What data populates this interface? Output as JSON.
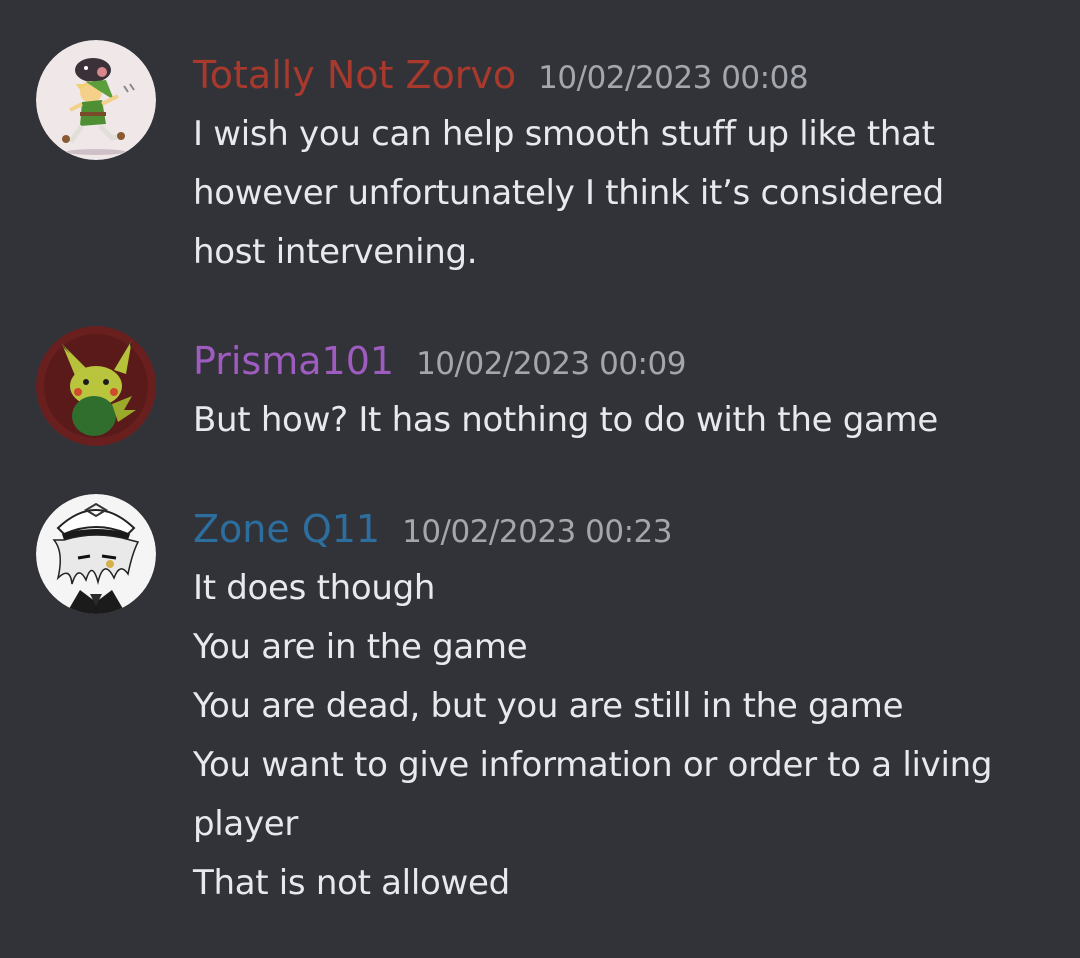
{
  "colors": {
    "background": "#323339",
    "text": "#e8e9ec",
    "timestamp": "#a3a6ad"
  },
  "messages": [
    {
      "author": "Totally Not Zorvo",
      "author_color": "#a8392c",
      "timestamp": "10/02/2023 00:08",
      "avatar_icon": "cartoon-elf-with-boar-avatar",
      "lines": [
        "I wish you can help smooth stuff up like that",
        "however unfortunately I think it’s considered",
        "host intervening."
      ]
    },
    {
      "author": "Prisma101",
      "author_color": "#9f5cc0",
      "timestamp": "10/02/2023 00:09",
      "avatar_icon": "green-pikachu-avatar",
      "lines": [
        "But how? It has nothing to do with the game"
      ]
    },
    {
      "author": "Zone Q11",
      "author_color": "#2c6e9e",
      "timestamp": "10/02/2023 00:23",
      "avatar_icon": "anime-officer-cap-avatar",
      "lines": [
        "It does though",
        "You are in the game",
        "You are dead, but you are still in the game",
        "You want to give information or order to a living",
        "player",
        "That is not allowed"
      ]
    }
  ]
}
